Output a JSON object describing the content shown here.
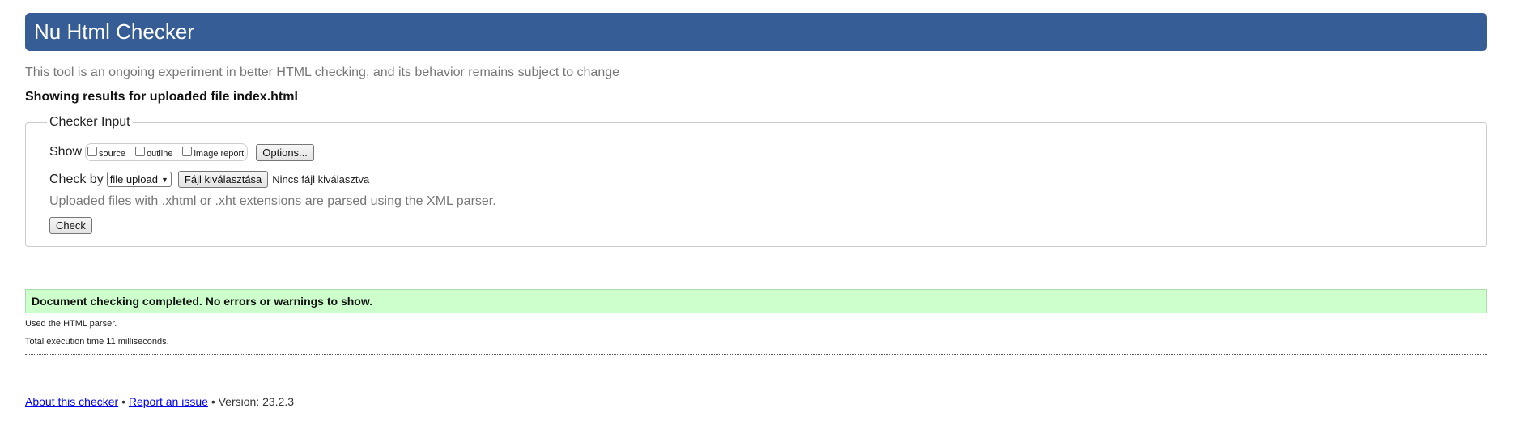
{
  "header": {
    "title": "Nu Html Checker",
    "accent_color": "#365d95"
  },
  "intro_text": "This tool is an ongoing experiment in better HTML checking, and its behavior remains subject to change",
  "results_heading": "Showing results for uploaded file index.html",
  "checker_input": {
    "legend": "Checker Input",
    "show_label": "Show",
    "show_options": [
      {
        "label": "source",
        "checked": false
      },
      {
        "label": "outline",
        "checked": false
      },
      {
        "label": "image report",
        "checked": false
      }
    ],
    "options_button": "Options...",
    "check_by_label": "Check by",
    "check_by_selected": "file upload",
    "file_button": "Fájl kiválasztása",
    "file_status": "Nincs fájl kiválasztva",
    "hint": "Uploaded files with .xhtml or .xht extensions are parsed using the XML parser.",
    "check_button": "Check"
  },
  "result": {
    "message": "Document checking completed. No errors or warnings to show.",
    "background_color": "#ccffcc",
    "parser_note": "Used the HTML parser.",
    "execution_time": "Total execution time 11 milliseconds."
  },
  "footer": {
    "about_link": "About this checker",
    "separator": "•",
    "report_link": "Report an issue",
    "version": "Version: 23.2.3"
  }
}
